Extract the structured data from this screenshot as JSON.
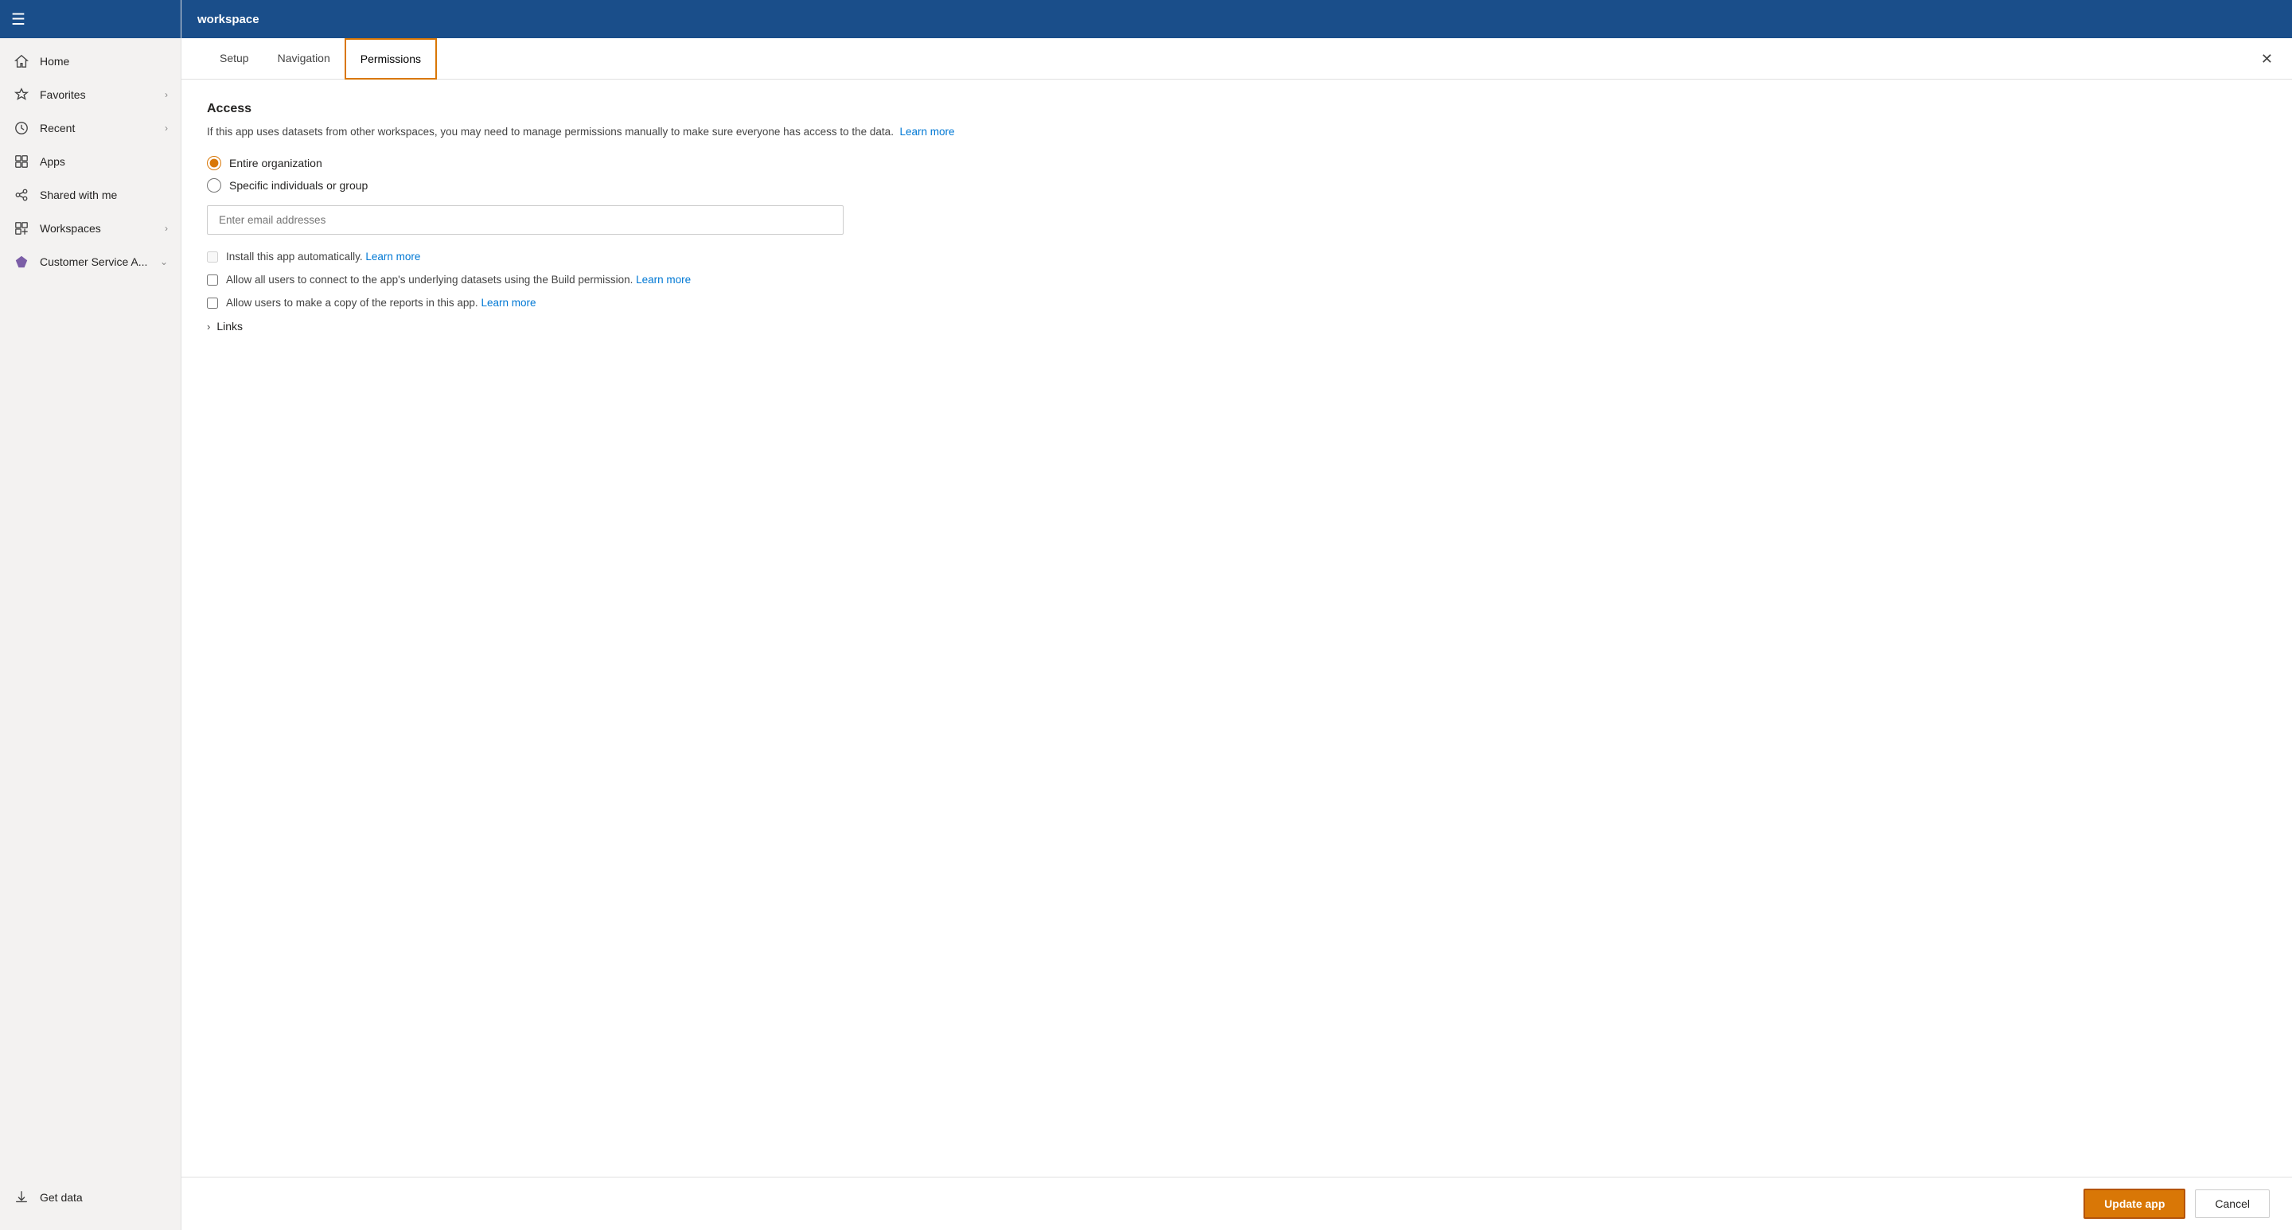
{
  "app": {
    "title": "workspace"
  },
  "sidebar": {
    "hamburger_label": "☰",
    "items": [
      {
        "id": "home",
        "label": "Home",
        "icon": "home"
      },
      {
        "id": "favorites",
        "label": "Favorites",
        "icon": "star",
        "chevron": true
      },
      {
        "id": "recent",
        "label": "Recent",
        "icon": "clock",
        "chevron": true
      },
      {
        "id": "apps",
        "label": "Apps",
        "icon": "apps"
      },
      {
        "id": "shared-with-me",
        "label": "Shared with me",
        "icon": "share"
      },
      {
        "id": "workspaces",
        "label": "Workspaces",
        "icon": "workspaces",
        "chevron": true
      },
      {
        "id": "customer-service",
        "label": "Customer Service A...",
        "icon": "purple-gem",
        "chevron": "down"
      }
    ],
    "bottom": [
      {
        "id": "get-data",
        "label": "Get data",
        "icon": "get-data"
      }
    ]
  },
  "tabs": {
    "items": [
      {
        "id": "setup",
        "label": "Setup",
        "active": false
      },
      {
        "id": "navigation",
        "label": "Navigation",
        "active": false
      },
      {
        "id": "permissions",
        "label": "Permissions",
        "active": true
      }
    ]
  },
  "permissions": {
    "section_title": "Access",
    "description": "If this app uses datasets from other workspaces, you may need to manage permissions manually to make sure everyone has access to the data.",
    "learn_more_link_1": "Learn more",
    "radio_options": [
      {
        "id": "entire-org",
        "label": "Entire organization",
        "checked": true
      },
      {
        "id": "specific-individuals",
        "label": "Specific individuals or group",
        "checked": false
      }
    ],
    "email_placeholder": "Enter email addresses",
    "checkboxes": [
      {
        "id": "install-auto",
        "label": "Install this app automatically.",
        "learn_more": "Learn more",
        "checked": false,
        "disabled": true
      },
      {
        "id": "allow-build",
        "label": "Allow all users to connect to the app's underlying datasets using the Build permission.",
        "learn_more": "Learn more",
        "checked": false,
        "disabled": false
      },
      {
        "id": "allow-copy",
        "label": "Allow users to make a copy of the reports in this app.",
        "learn_more": "Learn more",
        "checked": false,
        "disabled": false
      }
    ],
    "links_section_label": "Links"
  },
  "footer": {
    "update_label": "Update app",
    "cancel_label": "Cancel"
  }
}
